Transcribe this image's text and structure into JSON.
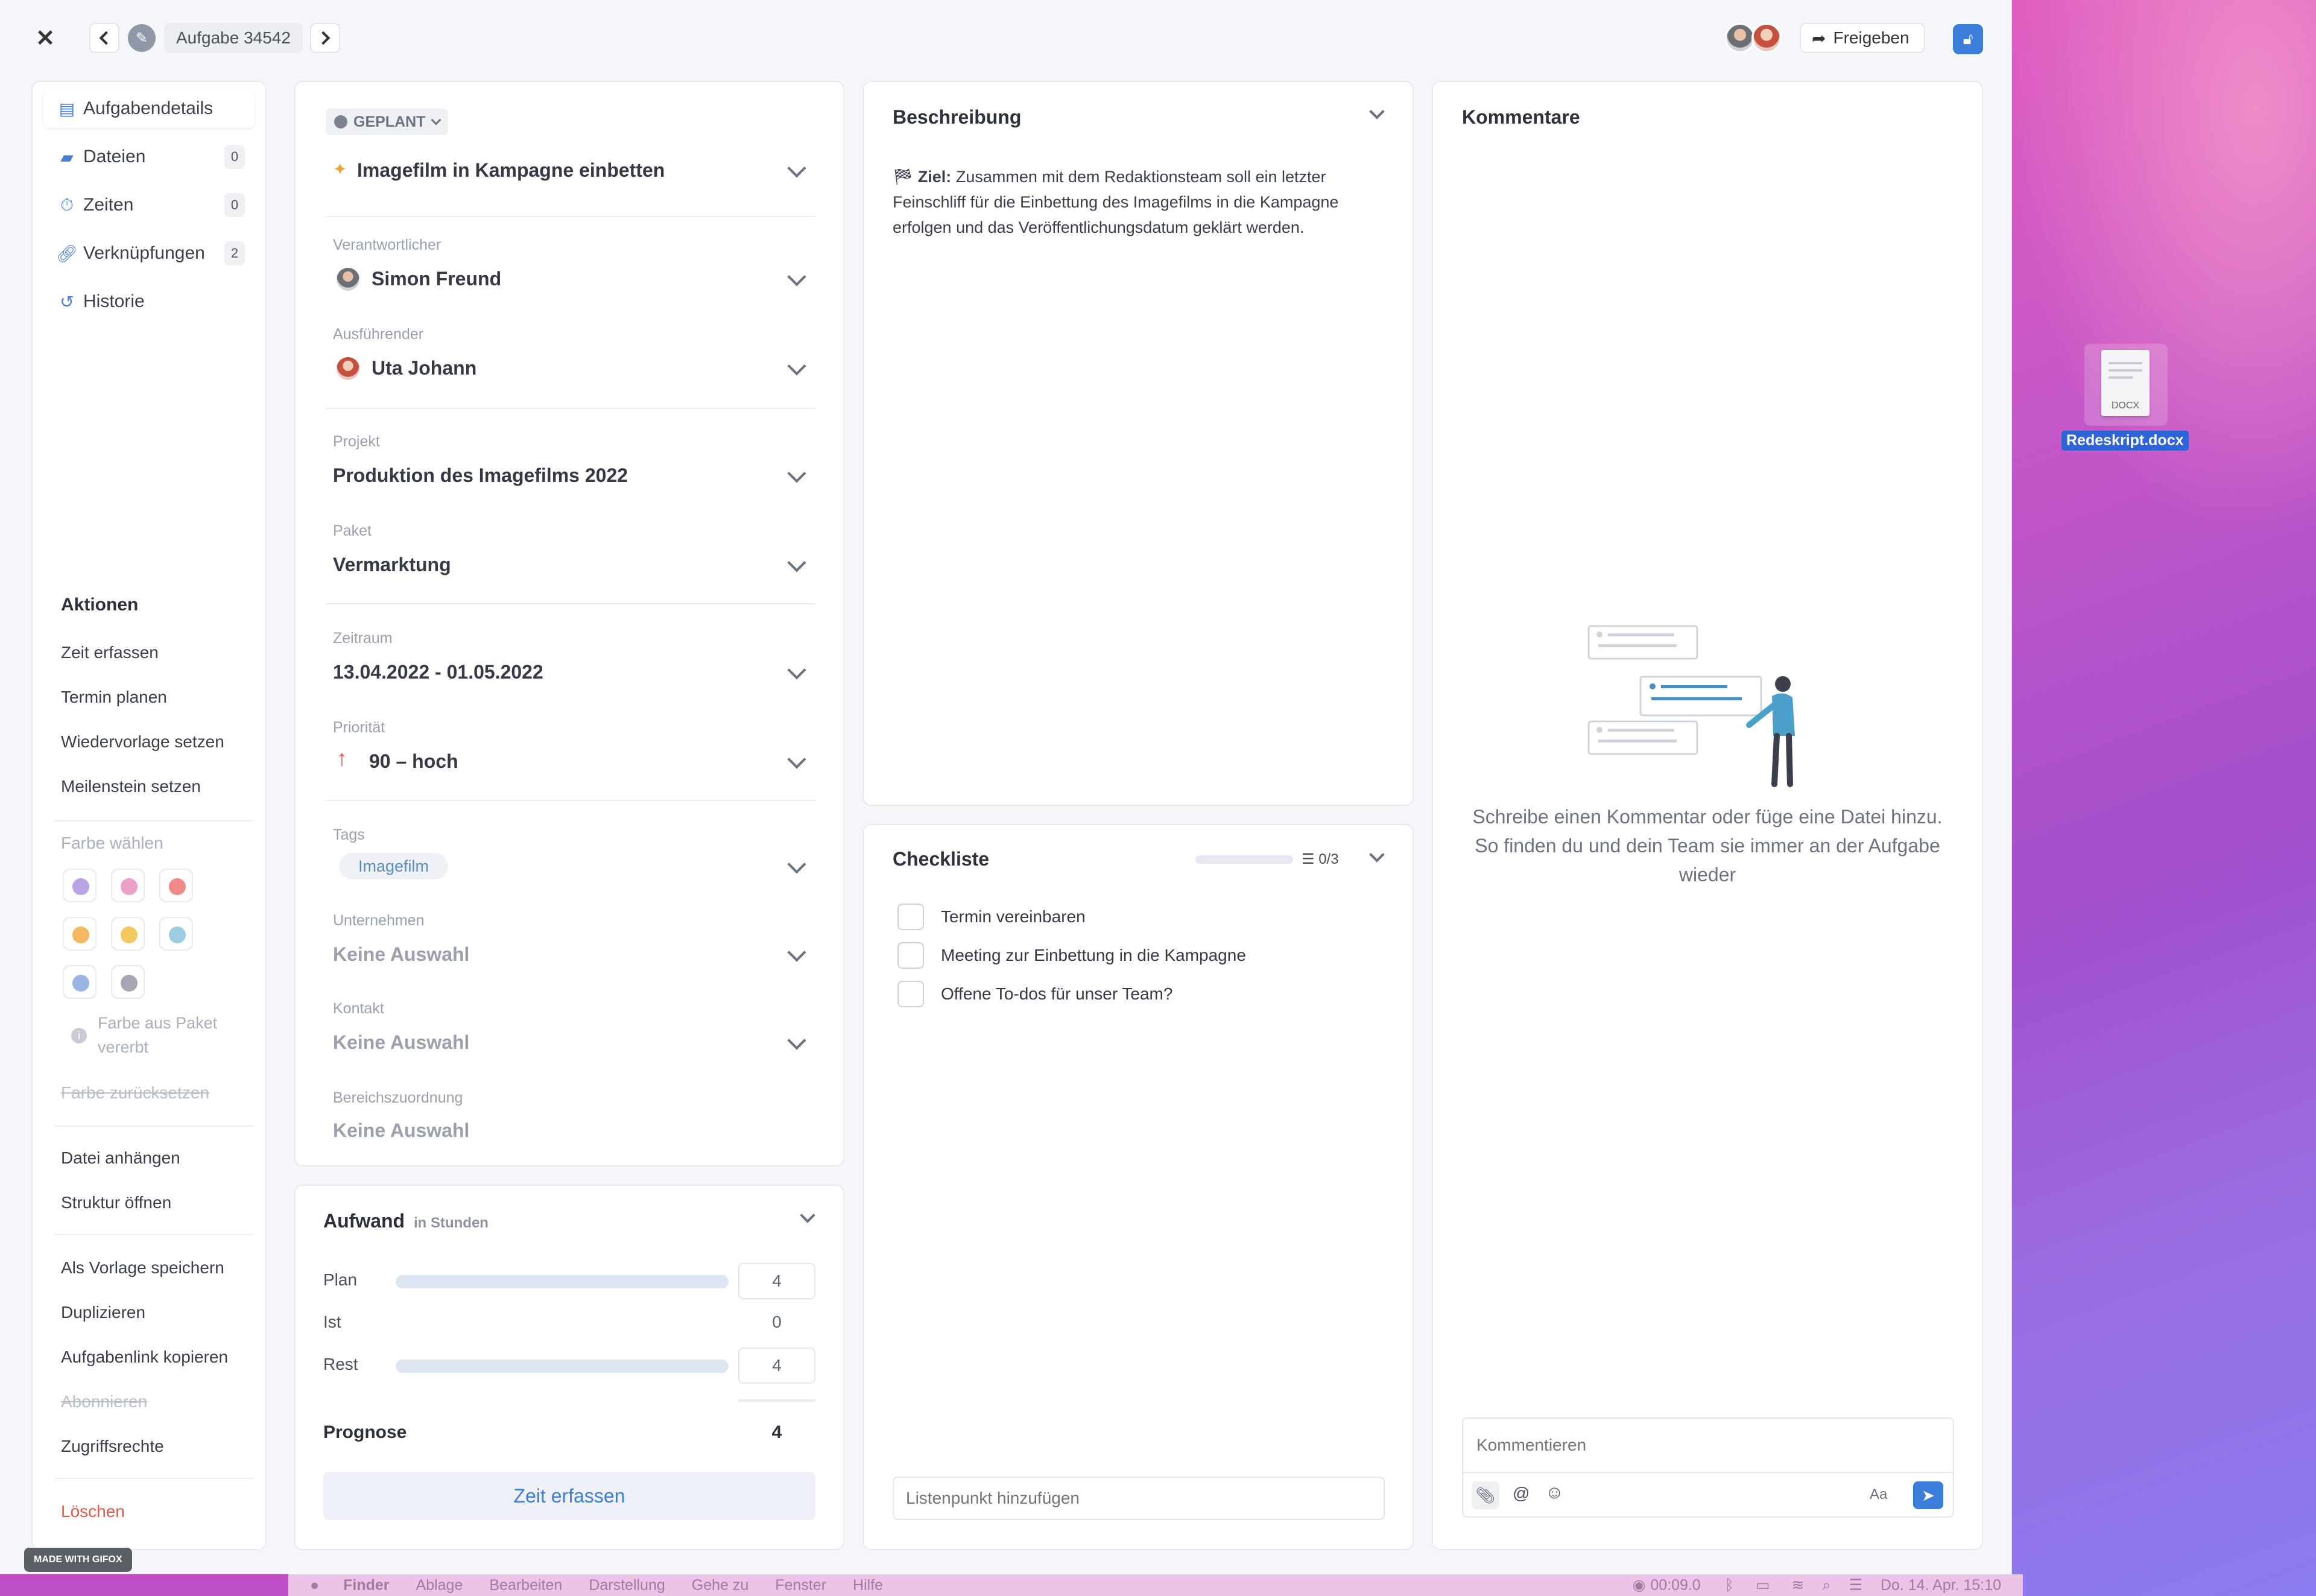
{
  "header": {
    "task_title": "Aufgabe 34542",
    "share_label": "Freigeben"
  },
  "sidebar": {
    "items": [
      {
        "label": "Aufgabendetails",
        "badge": ""
      },
      {
        "label": "Dateien",
        "badge": "0"
      },
      {
        "label": "Zeiten",
        "badge": "0"
      },
      {
        "label": "Verknüpfungen",
        "badge": "2"
      },
      {
        "label": "Historie",
        "badge": ""
      }
    ],
    "actions_title": "Aktionen",
    "actions": [
      "Zeit erfassen",
      "Termin planen",
      "Wiedervorlage setzen",
      "Meilenstein setzen"
    ],
    "color_title": "Farbe wählen",
    "colors": [
      "#b8a4e4",
      "#eaa0c8",
      "#f08a8a",
      "#f4b860",
      "#f4c860",
      "#9dcbe0",
      "#9ab4e4",
      "#a4a8b4"
    ],
    "inherit_note": "Farbe aus Paket vererbt",
    "reset_color": "Farbe zurücksetzen",
    "more_actions_1": [
      "Datei anhängen",
      "Struktur öffnen"
    ],
    "more_actions_2": [
      "Als Vorlage speichern",
      "Duplizieren",
      "Aufgabenlink kopieren",
      "Abonnieren",
      "Zugriffsrechte"
    ],
    "delete": "Löschen"
  },
  "details": {
    "status": "GEPLANT",
    "title": "Imagefilm in Kampagne einbetten",
    "responsible_label": "Verantwortlicher",
    "responsible": "Simon Freund",
    "executor_label": "Ausführender",
    "executor": "Uta Johann",
    "project_label": "Projekt",
    "project": "Produktion des Imagefilms 2022",
    "package_label": "Paket",
    "package": "Vermarktung",
    "period_label": "Zeitraum",
    "period": "13.04.2022 - 01.05.2022",
    "priority_label": "Priorität",
    "priority": "90 – hoch",
    "tags_label": "Tags",
    "tag": "Imagefilm",
    "company_label": "Unternehmen",
    "company": "Keine Auswahl",
    "contact_label": "Kontakt",
    "contact": "Keine Auswahl",
    "area_label": "Bereichszuordnung",
    "area": "Keine Auswahl"
  },
  "effort": {
    "title": "Aufwand",
    "unit": "in Stunden",
    "plan_label": "Plan",
    "plan": "4",
    "actual_label": "Ist",
    "actual": "0",
    "rest_label": "Rest",
    "rest": "4",
    "forecast_label": "Prognose",
    "forecast": "4",
    "button": "Zeit erfassen"
  },
  "description": {
    "title": "Beschreibung",
    "goal_label": "Ziel:",
    "text": "Zusammen mit dem Redaktionsteam soll ein letzter Feinschliff für die Einbettung des Imagefilms in die Kampagne erfolgen und das Veröffentlichungsdatum geklärt werden."
  },
  "checklist": {
    "title": "Checkliste",
    "count": "0/3",
    "items": [
      "Termin vereinbaren",
      "Meeting zur Einbettung in die Kampagne",
      "Offene To-dos für unser Team?"
    ],
    "add_placeholder": "Listenpunkt hinzufügen"
  },
  "comments": {
    "title": "Kommentare",
    "empty_text": "Schreibe einen Kommentar oder füge eine Datei hinzu. So finden du und dein Team sie immer an der Aufgabe wieder",
    "input_placeholder": "Kommentieren",
    "format_label": "Aa"
  },
  "desktop": {
    "file_name": "Redeskript.docx",
    "file_ext": "DOCX"
  },
  "watermark": "MADE WITH GIFOX",
  "menubar": {
    "items": [
      "Finder",
      "Ablage",
      "Bearbeiten",
      "Darstellung",
      "Gehe zu",
      "Fenster",
      "Hilfe"
    ],
    "timer": "00:09.0",
    "clock": "Do. 14. Apr. 15:10"
  }
}
